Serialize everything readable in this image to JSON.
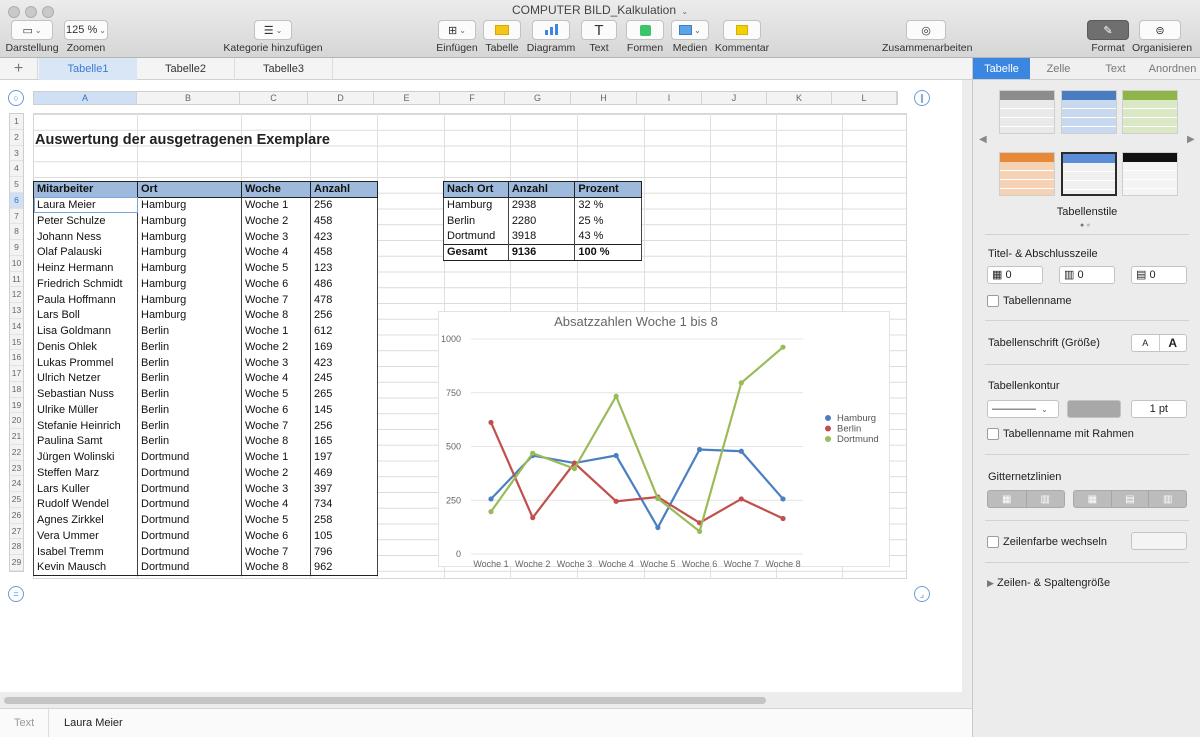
{
  "window": {
    "title": "COMPUTER BILD_Kalkulation"
  },
  "toolbar": {
    "darstellung": "Darstellung",
    "zoom_value": "125 %",
    "zoomen": "Zoomen",
    "kategorie": "Kategorie hinzufügen",
    "einfuegen": "Einfügen",
    "tabelle": "Tabelle",
    "diagramm": "Diagramm",
    "text": "Text",
    "text_glyph": "T",
    "formen": "Formen",
    "medien": "Medien",
    "kommentar": "Kommentar",
    "zusammenarbeiten": "Zusammenarbeiten",
    "format": "Format",
    "organisieren": "Organisieren"
  },
  "sheets": [
    "Tabelle1",
    "Tabelle2",
    "Tabelle3"
  ],
  "columns": [
    "A",
    "B",
    "C",
    "D",
    "E",
    "F",
    "G",
    "H",
    "I",
    "J",
    "K",
    "L"
  ],
  "rows": [
    "1",
    "2",
    "3",
    "4",
    "5",
    "6",
    "7",
    "8",
    "9",
    "10",
    "11",
    "12",
    "13",
    "14",
    "15",
    "16",
    "17",
    "18",
    "19",
    "20",
    "21",
    "22",
    "23",
    "24",
    "25",
    "26",
    "27",
    "28",
    "29"
  ],
  "title": "Auswertung der ausgetragenen Exemplare",
  "main_table": {
    "headers": [
      "Mitarbeiter",
      "Ort",
      "Woche",
      "Anzahl"
    ],
    "rows": [
      [
        "Laura Meier",
        "Hamburg",
        "Woche 1",
        "256"
      ],
      [
        "Peter Schulze",
        "Hamburg",
        "Woche 2",
        "458"
      ],
      [
        "Johann Ness",
        "Hamburg",
        "Woche 3",
        "423"
      ],
      [
        "Olaf Palauski",
        "Hamburg",
        "Woche 4",
        "458"
      ],
      [
        "Heinz Hermann",
        "Hamburg",
        "Woche 5",
        "123"
      ],
      [
        "Friedrich Schmidt",
        "Hamburg",
        "Woche 6",
        "486"
      ],
      [
        "Paula Hoffmann",
        "Hamburg",
        "Woche 7",
        "478"
      ],
      [
        "Lars Boll",
        "Hamburg",
        "Woche 8",
        "256"
      ],
      [
        "Lisa Goldmann",
        "Berlin",
        "Woche 1",
        "612"
      ],
      [
        "Denis Ohlek",
        "Berlin",
        "Woche 2",
        "169"
      ],
      [
        "Lukas Prommel",
        "Berlin",
        "Woche 3",
        "423"
      ],
      [
        "Ulrich Netzer",
        "Berlin",
        "Woche 4",
        "245"
      ],
      [
        "Sebastian Nuss",
        "Berlin",
        "Woche 5",
        "265"
      ],
      [
        "Ulrike Müller",
        "Berlin",
        "Woche 6",
        "145"
      ],
      [
        "Stefanie Heinrich",
        "Berlin",
        "Woche 7",
        "256"
      ],
      [
        "Paulina Samt",
        "Berlin",
        "Woche 8",
        "165"
      ],
      [
        "Jürgen Wolinski",
        "Dortmund",
        "Woche 1",
        "197"
      ],
      [
        "Steffen Marz",
        "Dortmund",
        "Woche 2",
        "469"
      ],
      [
        "Lars Kuller",
        "Dortmund",
        "Woche 3",
        "397"
      ],
      [
        "Rudolf Wendel",
        "Dortmund",
        "Woche 4",
        "734"
      ],
      [
        "Agnes Zirkkel",
        "Dortmund",
        "Woche 5",
        "258"
      ],
      [
        "Vera Ummer",
        "Dortmund",
        "Woche 6",
        "105"
      ],
      [
        "Isabel Tremm",
        "Dortmund",
        "Woche 7",
        "796"
      ],
      [
        "Kevin Mausch",
        "Dortmund",
        "Woche 8",
        "962"
      ]
    ]
  },
  "summary_table": {
    "headers": [
      "Nach Ort",
      "Anzahl",
      "Prozent"
    ],
    "rows": [
      [
        "Hamburg",
        "2938",
        "32 %"
      ],
      [
        "Berlin",
        "2280",
        "25 %"
      ],
      [
        "Dortmund",
        "3918",
        "43 %"
      ]
    ],
    "total": [
      "Gesamt",
      "9136",
      "100 %"
    ]
  },
  "chart_data": {
    "type": "line",
    "title": "Absatzzahlen Woche 1 bis 8",
    "categories": [
      "Woche 1",
      "Woche 2",
      "Woche 3",
      "Woche 4",
      "Woche 5",
      "Woche 6",
      "Woche 7",
      "Woche 8"
    ],
    "series": [
      {
        "name": "Hamburg",
        "color": "#4a7fc1",
        "values": [
          256,
          458,
          423,
          458,
          123,
          486,
          478,
          256
        ]
      },
      {
        "name": "Berlin",
        "color": "#c0504d",
        "values": [
          612,
          169,
          423,
          245,
          265,
          145,
          256,
          165
        ]
      },
      {
        "name": "Dortmund",
        "color": "#9bbb59",
        "values": [
          197,
          469,
          397,
          734,
          258,
          105,
          796,
          962
        ]
      }
    ],
    "ylim": [
      0,
      1000
    ],
    "yticks": [
      "0",
      "250",
      "500",
      "750",
      "1000"
    ],
    "grid": true,
    "legend": "right"
  },
  "sidebar": {
    "tabs": [
      "Tabelle",
      "Zelle",
      "Text",
      "Anordnen"
    ],
    "styles_label": "Tabellenstile",
    "header_footer_label": "Titel- & Abschlusszeile",
    "header_rows": "0",
    "header_cols": "0",
    "footer_rows": "0",
    "table_name": "Tabellenname",
    "font_size_label": "Tabellenschrift (Größe)",
    "font_small": "A",
    "font_large": "A",
    "outline_label": "Tabellenkontur",
    "outline_width": "1 pt",
    "outline_name": "Tabellenname mit Rahmen",
    "gridlines_label": "Gitternetzlinien",
    "alternate_rows": "Zeilenfarbe wechseln",
    "row_col_size": "Zeilen- & Spaltengröße"
  },
  "status": {
    "mode": "Text",
    "cell_value": "Laura Meier"
  }
}
